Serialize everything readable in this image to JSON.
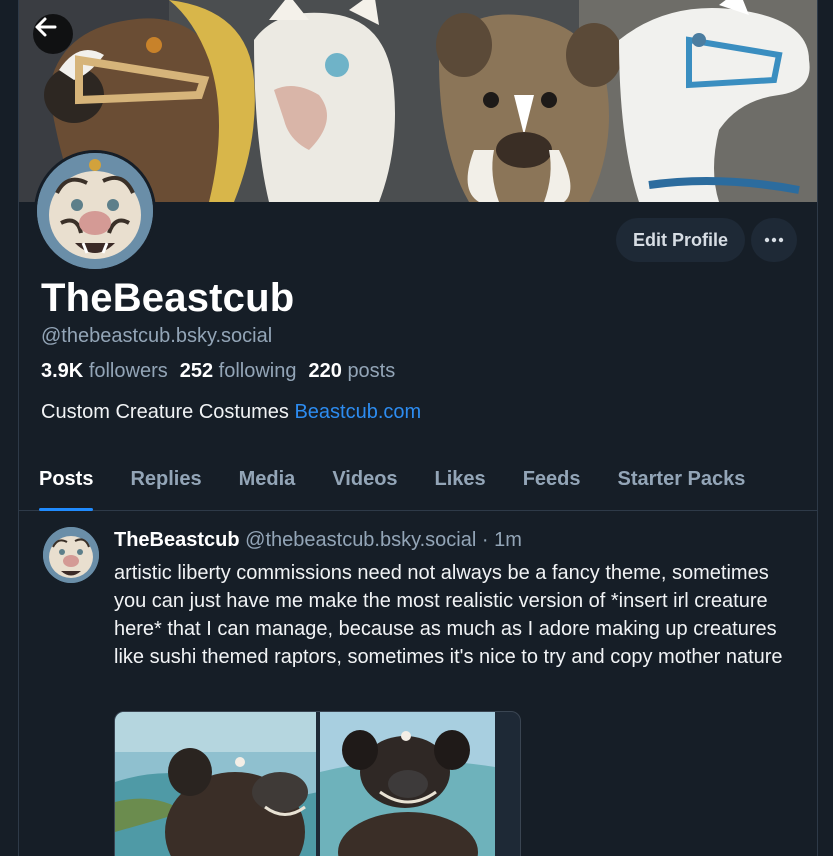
{
  "profile": {
    "display_name": "TheBeastcub",
    "handle": "@thebeastcub.bsky.social",
    "followers_count": "3.9K",
    "followers_label": "followers",
    "following_count": "252",
    "following_label": "following",
    "posts_count": "220",
    "posts_label": "posts",
    "bio_text": "Custom Creature Costumes",
    "bio_link": "Beastcub.com"
  },
  "actions": {
    "edit_label": "Edit Profile",
    "more_icon": "ellipsis-icon",
    "back_icon": "arrow-left-icon"
  },
  "tabs": [
    {
      "label": "Posts",
      "active": true
    },
    {
      "label": "Replies"
    },
    {
      "label": "Media"
    },
    {
      "label": "Videos"
    },
    {
      "label": "Likes"
    },
    {
      "label": "Feeds"
    },
    {
      "label": "Starter Packs"
    }
  ],
  "post": {
    "author": "TheBeastcub",
    "handle": "@thebeastcub.bsky.social",
    "separator": "·",
    "time": "1m",
    "text": "artistic liberty commissions need not always be a fancy theme, sometimes you can just have me make the most realistic version of *insert irl creature here* that I can manage, because as much as I adore making up creatures like sushi themed raptors, sometimes it's nice to try and copy mother nature"
  },
  "colors": {
    "background": "#161e27",
    "accent": "#208bfe",
    "link": "#2d8cf0",
    "muted_text": "#93a5b7",
    "button_bg": "#1e2936"
  }
}
